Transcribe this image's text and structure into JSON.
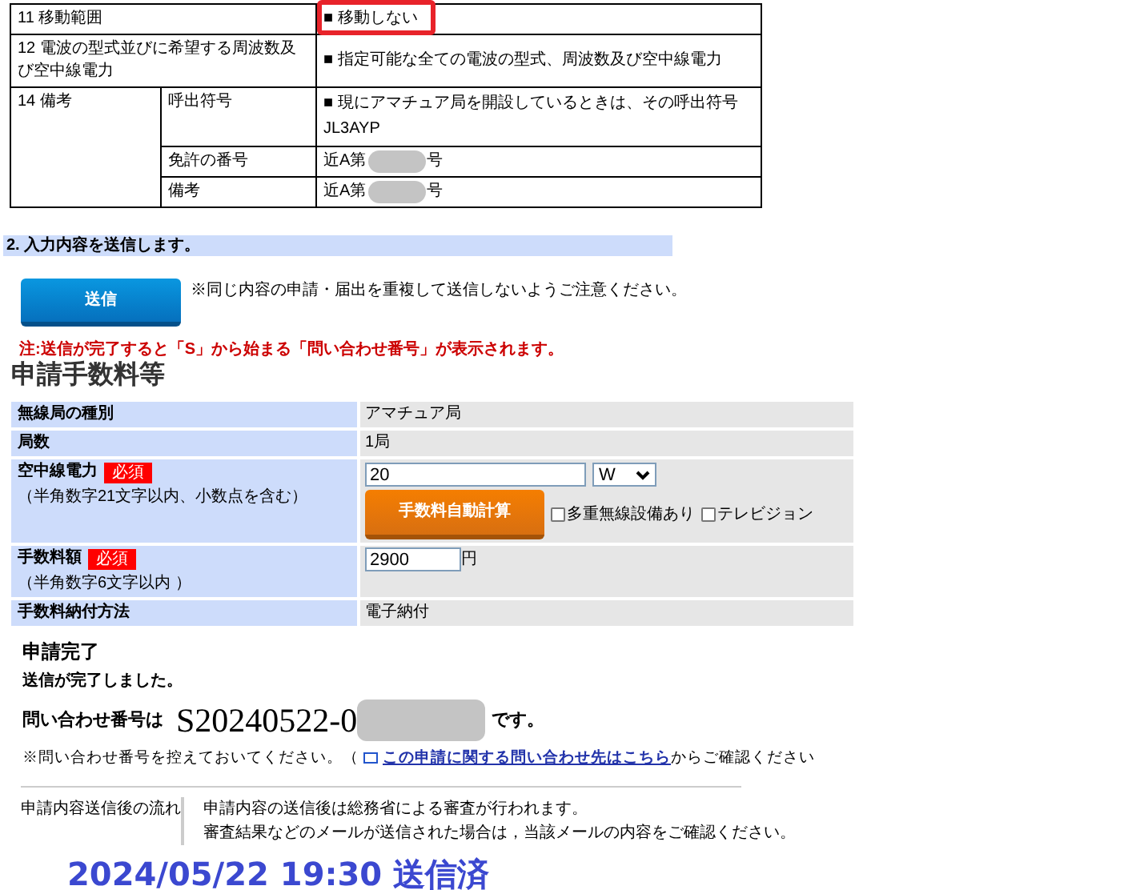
{
  "application_table": {
    "rows": [
      {
        "kind": "single",
        "label": "11 移動範囲",
        "value": "■ 移動しない",
        "highlighted": true
      },
      {
        "kind": "single",
        "label": "12 電波の型式並びに希望する周波数及び空中線電力",
        "value": "■ 指定可能な全ての電波の型式、周波数及び空中線電力",
        "highlighted": false
      },
      {
        "kind": "group",
        "label": "14 備考",
        "subrows": [
          {
            "kind": "lines",
            "label": "呼出符号",
            "lines": [
              "■ 現にアマチュア局を開設しているときは、その呼出符号",
              "JL3AYP"
            ]
          },
          {
            "kind": "masked",
            "label": "免許の番号",
            "prefix": "近A第",
            "suffix": "号",
            "redacted": true
          },
          {
            "kind": "masked",
            "label": "備考",
            "prefix": "近A第",
            "suffix": "号",
            "redacted": true
          }
        ]
      }
    ]
  },
  "send_section": {
    "header": "2. 入力内容を送信します。",
    "button": "送信",
    "caution": "※同じ内容の申請・届出を重複して送信しないようご注意ください。",
    "note": "注:送信が完了すると「S」から始まる「問い合わせ番号」が表示されます。"
  },
  "fee_section": {
    "title": "申請手数料等",
    "rows": [
      {
        "kind": "text",
        "label": "無線局の種別",
        "value": "アマチュア局"
      },
      {
        "kind": "text",
        "label": "局数",
        "value": "1局"
      },
      {
        "kind": "power",
        "label": "空中線電力",
        "badge": "必須",
        "hint": "（半角数字21文字以内、小数点を含む）",
        "value": "20",
        "unit": "W",
        "calc_button": "手数料自動計算",
        "checkboxes": [
          {
            "label": "多重無線設備あり",
            "checked": false
          },
          {
            "label": "テレビジョン",
            "checked": false
          }
        ]
      },
      {
        "kind": "fee",
        "label": "手数料額",
        "badge": "必須",
        "hint": "（半角数字6文字以内 ）",
        "value": "2900",
        "unit": "円"
      },
      {
        "kind": "text",
        "label": "手数料納付方法",
        "value": "電子納付"
      }
    ]
  },
  "completion": {
    "title": "申請完了",
    "message": "送信が完了しました。",
    "number_label": "問い合わせ番号は",
    "number": "S20240522-0",
    "number_redacted": true,
    "number_suffix": "です。",
    "note_before": "※問い合わせ番号を控えておいてください。（",
    "link": "この申請に関する問い合わせ先はこちら",
    "note_after": "からご確認ください"
  },
  "flow": {
    "label": "申請内容送信後の流れ",
    "lines": [
      "申請内容の送信後は総務省による審査が行われます。",
      "審査結果などのメールが送信された場合は，当該メールの内容をご確認ください。"
    ]
  },
  "stamp": "2024/05/22 19:30 送信済"
}
